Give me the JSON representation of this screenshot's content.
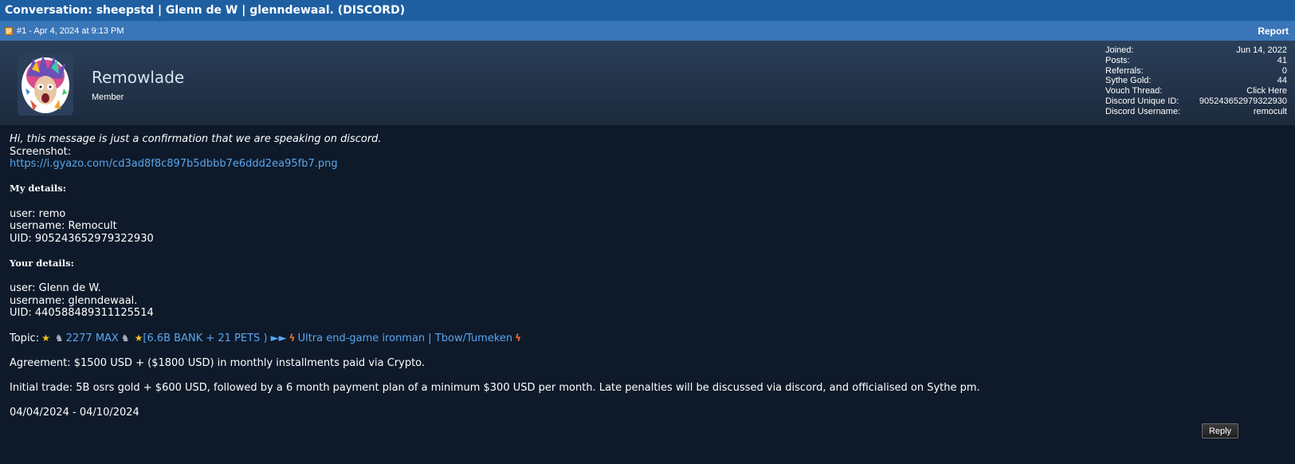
{
  "conversation": {
    "title": "Conversation: sheepstd | Glenn de W | glenndewaal. (DISCORD)"
  },
  "post": {
    "meta": "#1 - Apr 4, 2024 at 9:13 PM",
    "report_label": "Report",
    "author": {
      "name": "Remowlade",
      "title": "Member"
    },
    "stats": [
      {
        "label": "Joined:",
        "value": "Jun 14, 2022"
      },
      {
        "label": "Posts:",
        "value": "41"
      },
      {
        "label": "Referrals:",
        "value": "0"
      },
      {
        "label": "Sythe Gold:",
        "value": "44"
      },
      {
        "label": "Vouch Thread:",
        "value": "Click Here"
      },
      {
        "label": "Discord Unique ID:",
        "value": "905243652979322930"
      },
      {
        "label": "Discord Username:",
        "value": "remocult"
      }
    ],
    "body": {
      "intro": "Hi, this message is just a confirmation that we are speaking on discord.",
      "screenshot_label": "Screenshot:",
      "screenshot_url": "https://i.gyazo.com/cd3ad8f8c897b5dbbb7e6ddd2ea95fb7.png",
      "my_heading": "My details:",
      "my_user": "user: remo",
      "my_username": "username: Remocult",
      "my_uid": "UID: 905243652979322930",
      "your_heading": "Your details:",
      "your_user": "user: Glenn de W.",
      "your_username": "username: glenndewaal.",
      "your_uid": "UID: 440588489311125514",
      "topic_label": "Topic:",
      "topic_part1": "2277 MAX",
      "topic_part2": "[6.6B BANK + 21 PETS ) ►►",
      "topic_part3": "Ultra end-game ironman | Tbow/Tumeken",
      "agreement": "Agreement: $1500 USD + ($1800 USD) in monthly installments paid via Crypto.",
      "initial_trade": "Initial trade: 5B osrs gold + $600 USD, followed by a 6 month payment plan of a minimum $300 USD per month. Late penalties will be discussed via discord, and officialised on Sythe pm.",
      "dates": "04/04/2024 - 04/10/2024"
    },
    "reply_label": "Reply"
  },
  "colors": {
    "title_bar": "#1e5fa2",
    "meta_bar": "#3a76b8",
    "page_bg": "#0e1a2a",
    "link": "#5aa6ef"
  },
  "icons": {
    "post": "post-icon",
    "star": "star-icon",
    "knight": "knight-icon",
    "bolt": "lightning-icon"
  }
}
